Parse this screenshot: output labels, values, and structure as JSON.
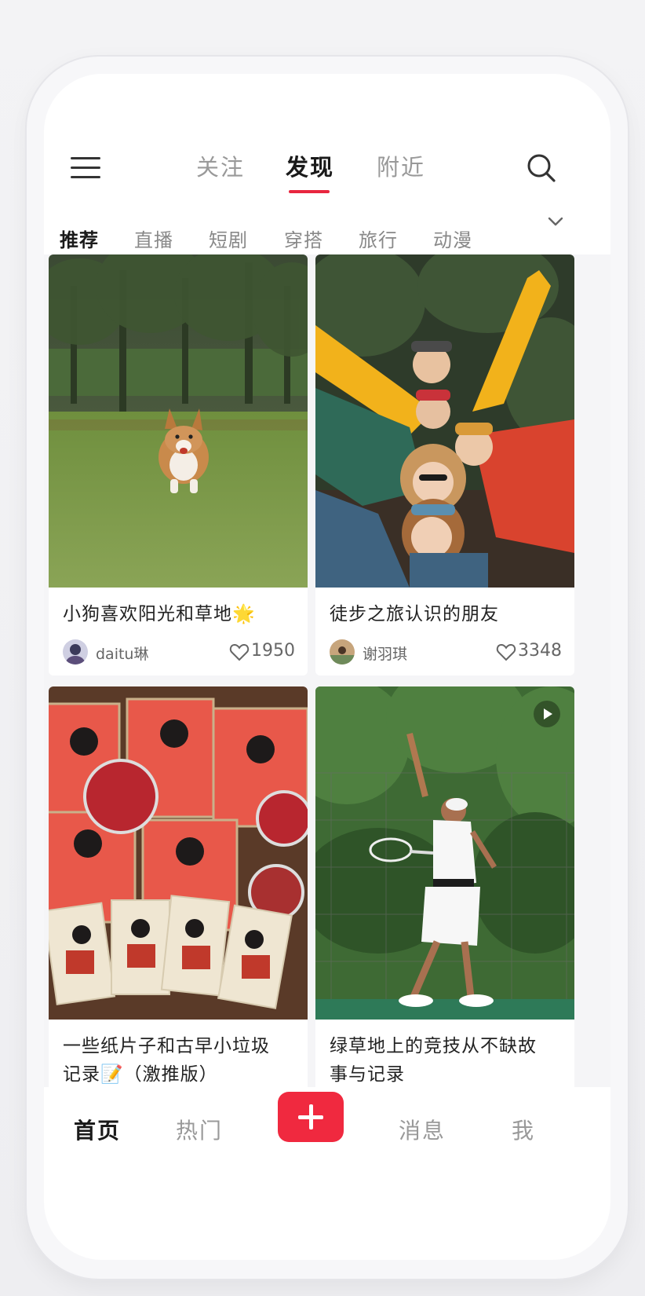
{
  "top_nav": {
    "tabs": [
      {
        "label": "关注",
        "active": false
      },
      {
        "label": "发现",
        "active": true
      },
      {
        "label": "附近",
        "active": false
      }
    ]
  },
  "categories": {
    "items": [
      "推荐",
      "直播",
      "短剧",
      "穿搭",
      "旅行",
      "动漫"
    ],
    "active": "推荐"
  },
  "feed": {
    "cards": [
      {
        "title": "小狗喜欢阳光和草地🌟",
        "author": "daitu琳",
        "likes": "1950",
        "image": "corgi running on green grass in a park"
      },
      {
        "title": "徒步之旅认识的朋友",
        "author": "谢羽琪",
        "likes": "3348",
        "image": "group of friends in colorful jackets posing outdoors"
      },
      {
        "title_line1": "一些纸片子和古早小垃圾",
        "title_line2": "记录📝（激推版）",
        "image": "anime character cards and badges on wooden table"
      },
      {
        "title_line1": "绿草地上的竞技从不缺故",
        "title_line2": "事与记录",
        "image": "tennis player serving on green court",
        "is_video": true
      }
    ]
  },
  "bottom_nav": {
    "items": [
      {
        "label": "首页",
        "active": true
      },
      {
        "label": "热门",
        "active": false
      },
      {
        "label": "消息",
        "active": false
      },
      {
        "label": "我",
        "active": false
      }
    ]
  },
  "colors": {
    "accent": "#e8263f",
    "publish": "#f0293f"
  },
  "icons": [
    "menu-icon",
    "search-icon",
    "chevron-down-icon",
    "heart-icon",
    "plus-icon",
    "play-icon"
  ]
}
